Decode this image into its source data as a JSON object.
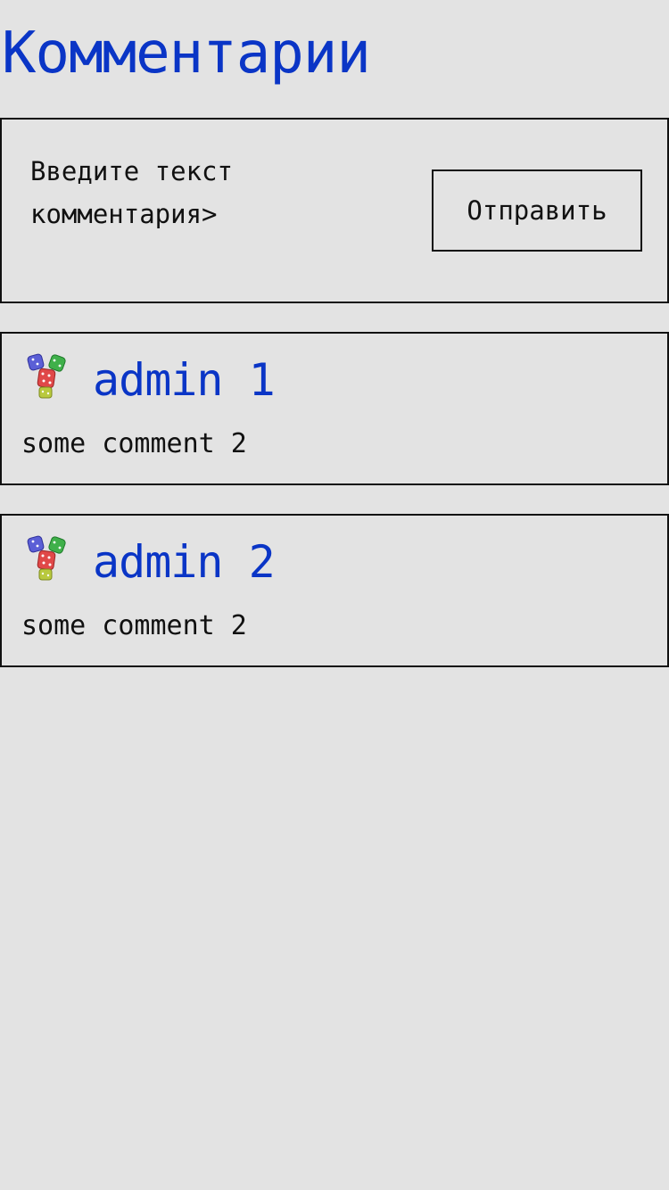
{
  "page": {
    "title": "Комментарии"
  },
  "composer": {
    "placeholder": "Введите текст комментария>",
    "value": "",
    "submit_label": "Отправить"
  },
  "comments": [
    {
      "author": "admin 1",
      "text": "some comment 2",
      "avatar_icon": "dice-icon"
    },
    {
      "author": "admin 2",
      "text": "some comment 2",
      "avatar_icon": "dice-icon"
    }
  ],
  "colors": {
    "accent": "#0a35c6",
    "background": "#e3e3e3",
    "text": "#111111"
  }
}
